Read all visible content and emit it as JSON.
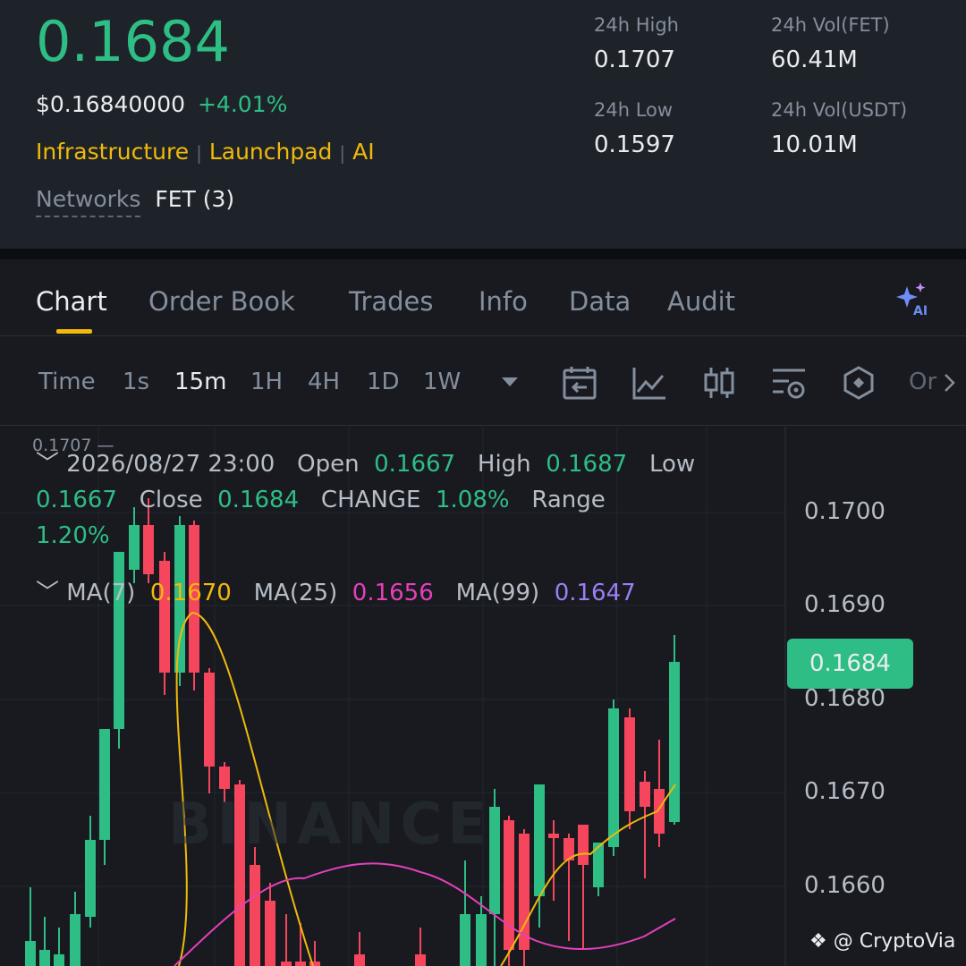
{
  "header": {
    "price": "0.1684",
    "usd_price": "$0.16840000",
    "change": "+4.01%",
    "tags": [
      "Infrastructure",
      "Launchpad",
      "AI"
    ],
    "networks_label": "Networks",
    "networks_value": "FET (3)",
    "stats": {
      "high_label": "24h High",
      "high_value": "0.1707",
      "low_label": "24h Low",
      "low_value": "0.1597",
      "vol_base_label": "24h Vol(FET)",
      "vol_base_value": "60.41M",
      "vol_quote_label": "24h Vol(USDT)",
      "vol_quote_value": "10.01M"
    }
  },
  "tabs": [
    "Chart",
    "Order Book",
    "Trades",
    "Info",
    "Data",
    "Audit"
  ],
  "active_tab": "Chart",
  "timeframes": {
    "label": "Time",
    "items": [
      "1s",
      "15m",
      "1H",
      "4H",
      "1D",
      "1W"
    ],
    "active": "15m",
    "more": "Or"
  },
  "chart": {
    "max_marker": "0.1707",
    "date": "2026/08/27 23:00",
    "open_label": "Open",
    "open": "0.1667",
    "high_label": "High",
    "high": "0.1687",
    "low_label": "Low",
    "low": "0.1667",
    "close_label": "Close",
    "close": "0.1684",
    "change_label": "CHANGE",
    "change": "1.08%",
    "range_label": "Range",
    "range": "1.20%",
    "ma7_label": "MA(7)",
    "ma7": "0.1670",
    "ma25_label": "MA(25)",
    "ma25": "0.1656",
    "ma99_label": "MA(99)",
    "ma99": "0.1647",
    "y_ticks": [
      "0.1700",
      "0.1690",
      "0.1680",
      "0.1670",
      "0.1660"
    ],
    "last_price": "0.1684",
    "watermark": "BINANCE",
    "colors": {
      "up": "#2ebd85",
      "down": "#f6465d",
      "ma7": "#f0b90b",
      "ma25": "#e440b9",
      "ma99": "#9b7ef5"
    }
  },
  "credit": "@ CryptoVia"
}
